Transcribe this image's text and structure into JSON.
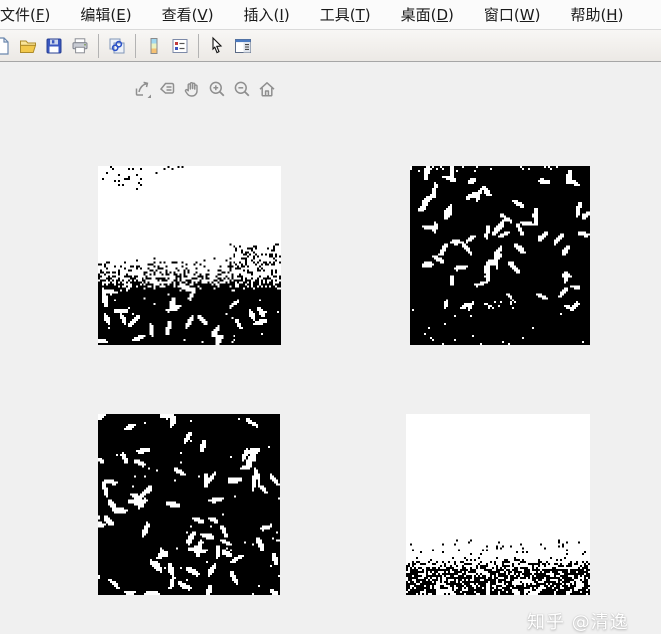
{
  "window": {
    "background": "#f0f0f0"
  },
  "menu_bar": {
    "items": [
      {
        "id": "file",
        "pre": "文件(",
        "key": "F",
        "post": ")"
      },
      {
        "id": "edit",
        "pre": "编辑(",
        "key": "E",
        "post": ")"
      },
      {
        "id": "view",
        "pre": "查看(",
        "key": "V",
        "post": ")"
      },
      {
        "id": "insert",
        "pre": "插入(",
        "key": "I",
        "post": ")"
      },
      {
        "id": "tools",
        "pre": "工具(",
        "key": "T",
        "post": ")"
      },
      {
        "id": "desktop",
        "pre": "桌面(",
        "key": "D",
        "post": ")"
      },
      {
        "id": "window",
        "pre": "窗口(",
        "key": "W",
        "post": ")"
      },
      {
        "id": "help",
        "pre": "帮助(",
        "key": "H",
        "post": ")"
      }
    ]
  },
  "toolbar": {
    "buttons": [
      "new-figure",
      "open-file",
      "save-figure",
      "print-figure",
      "link-plot",
      "insert-colorbar",
      "insert-legend",
      "edit-plot",
      "property-editor"
    ]
  },
  "axes_toolbar": {
    "buttons": [
      "export",
      "data-tips",
      "pan",
      "zoom-in",
      "zoom-out",
      "restore-view"
    ],
    "icon_color": "#8f8f8f"
  },
  "figure": {
    "description": "Four binary (black & white) thresholded versions of the rice-grains image",
    "images": [
      {
        "target": "binary-image-top-left",
        "seed": 11,
        "layers": [
          {
            "type": "fill",
            "color": "#ffffff"
          },
          {
            "type": "speckles",
            "color": "#000000",
            "region": [
              0.0,
              0.0,
              0.28,
              0.13
            ],
            "count": 22
          },
          {
            "type": "speckles",
            "color": "#000000",
            "region": [
              0.3,
              0.0,
              0.52,
              0.04
            ],
            "count": 6
          },
          {
            "type": "band",
            "color": "#000000",
            "y0": 0.5,
            "y1": 0.6,
            "p0": 0.0,
            "p1": 0.25
          },
          {
            "type": "speckles",
            "color": "#000000",
            "region": [
              0.72,
              0.44,
              1.0,
              0.56
            ],
            "count": 80
          },
          {
            "type": "band",
            "color": "#000000",
            "y0": 0.6,
            "y1": 0.7,
            "p0": 0.25,
            "p1": 1.0
          },
          {
            "type": "rect",
            "color": "#000000",
            "region": [
              0,
              0.7,
              1,
              1
            ]
          },
          {
            "type": "grains",
            "color": "#ffffff",
            "region": [
              0.0,
              0.64,
              1.0,
              1.03
            ],
            "count": 27,
            "rlMin": 3.0,
            "rlMax": 4.2,
            "rwMin": 1.0,
            "rwMax": 1.4
          },
          {
            "type": "speckles",
            "color": "#ffffff",
            "region": [
              0,
              0.62,
              1,
              1
            ],
            "count": 28
          }
        ]
      },
      {
        "target": "binary-image-top-right",
        "seed": 22,
        "layers": [
          {
            "type": "fill",
            "color": "#000000"
          },
          {
            "type": "speckles",
            "color": "#ffffff",
            "region": [
              0,
              0,
              1,
              0.03
            ],
            "count": 25
          },
          {
            "type": "grains",
            "color": "#ffffff",
            "region": [
              0.02,
              0.02,
              0.98,
              0.62
            ],
            "count": 48,
            "rlMin": 3.0,
            "rlMax": 4.3,
            "rwMin": 1.0,
            "rwMax": 1.4
          },
          {
            "type": "grains",
            "color": "#ffffff",
            "region": [
              0.0,
              0.6,
              1.0,
              0.8
            ],
            "count": 12,
            "rlMin": 2.2,
            "rlMax": 3.4,
            "rwMin": 0.8,
            "rwMax": 1.2
          },
          {
            "type": "speckles",
            "color": "#ffffff",
            "region": [
              0,
              0.8,
              1,
              1
            ],
            "count": 18
          },
          {
            "type": "speckles",
            "color": "#ffffff",
            "region": [
              0.42,
              0.76,
              0.58,
              0.8
            ],
            "count": 14
          }
        ]
      },
      {
        "target": "binary-image-bottom-left",
        "seed": 33,
        "layers": [
          {
            "type": "fill",
            "color": "#000000"
          },
          {
            "type": "grains",
            "color": "#ffffff",
            "region": [
              -0.02,
              -0.02,
              1.02,
              1.04
            ],
            "count": 72,
            "rlMin": 3.0,
            "rlMax": 4.3,
            "rwMin": 1.0,
            "rwMax": 1.45
          },
          {
            "type": "speckles",
            "color": "#ffffff",
            "region": [
              0,
              0,
              1,
              1
            ],
            "count": 45
          }
        ]
      },
      {
        "target": "binary-image-bottom-right",
        "seed": 44,
        "layers": [
          {
            "type": "fill",
            "color": "#ffffff"
          },
          {
            "type": "speckles",
            "color": "#000000",
            "region": [
              0,
              0.7,
              1,
              0.78
            ],
            "count": 40
          },
          {
            "type": "band",
            "color": "#000000",
            "y0": 0.78,
            "y1": 0.86,
            "p0": 0.0,
            "p1": 0.55
          },
          {
            "type": "band",
            "color": "#000000",
            "y0": 0.86,
            "y1": 1.0,
            "p0": 0.55,
            "p1": 0.8
          },
          {
            "type": "grains",
            "color": "#ffffff",
            "region": [
              0.02,
              0.87,
              0.98,
              1.0
            ],
            "count": 11,
            "rlMin": 2.8,
            "rlMax": 4.0,
            "rwMin": 1.1,
            "rwMax": 1.5
          },
          {
            "type": "speckles",
            "color": "#000000",
            "region": [
              0,
              0.86,
              1,
              1
            ],
            "count": 70
          }
        ]
      }
    ]
  },
  "watermark": {
    "text": "知乎 @清逸"
  }
}
